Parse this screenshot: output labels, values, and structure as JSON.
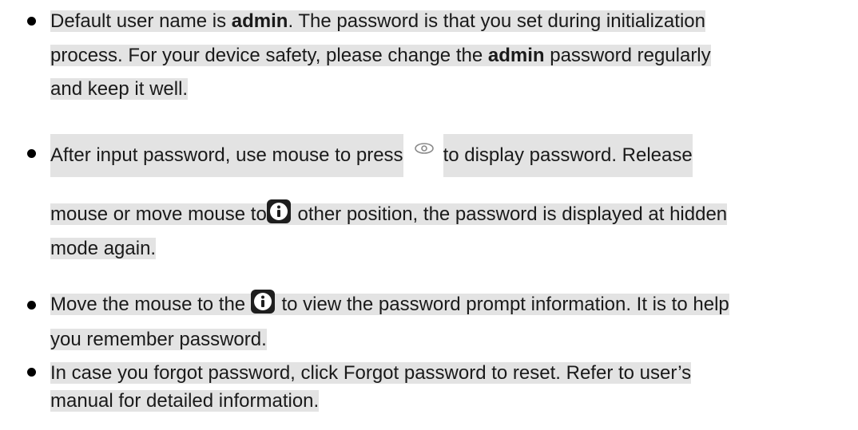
{
  "bullets": [
    {
      "lines": [
        {
          "parts": [
            "Default user name is ",
            "admin",
            ". The password is that you set during initialization"
          ]
        },
        {
          "parts": [
            "process. For your device safety, please change the ",
            "admin",
            " password regularly"
          ]
        },
        {
          "parts": [
            "and keep it well."
          ]
        }
      ]
    },
    {
      "lines": [
        {
          "parts": [
            "After input password, use mouse to press ",
            " to display password. Release"
          ],
          "icon": "eye-icon"
        },
        {
          "parts": [
            "mouse or move mouse to",
            " other position, the password is displayed at hidden"
          ],
          "icon": "info-icon"
        },
        {
          "parts": [
            "mode again."
          ]
        }
      ]
    },
    {
      "lines": [
        {
          "parts": [
            "Move the mouse to the ",
            " to view the password prompt information. It is to help"
          ],
          "icon": "info-icon"
        },
        {
          "parts": [
            "you remember password."
          ]
        }
      ]
    },
    {
      "lines": [
        {
          "parts": [
            "In case you forgot password, click Forgot password to reset. Refer to user’s"
          ]
        },
        {
          "parts": [
            "manual for detailed information."
          ]
        }
      ]
    }
  ],
  "colors": {
    "highlight": "#e3e3e3",
    "text": "#1a1a1a",
    "bullet": "#000000",
    "icon_bg": "#1e1e1e"
  }
}
